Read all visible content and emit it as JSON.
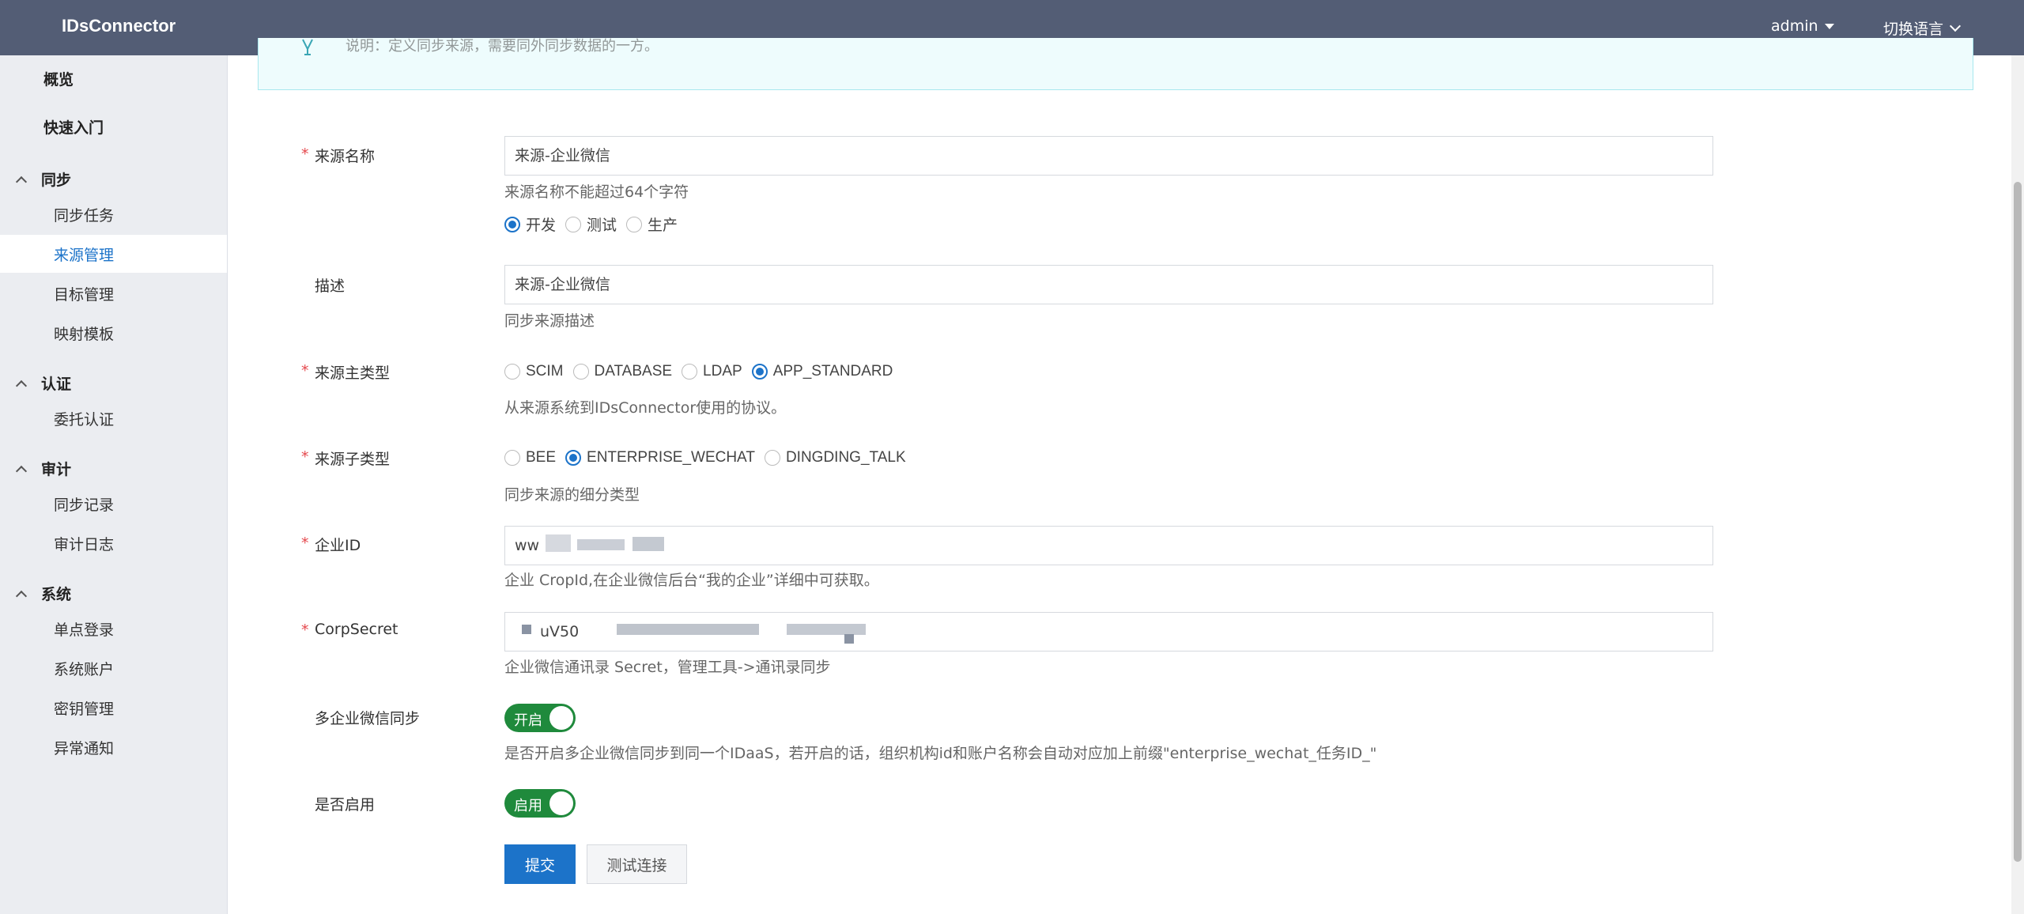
{
  "header": {
    "app_title": "IDsConnector",
    "user": "admin",
    "language": "切换语言"
  },
  "sidebar": {
    "overview": "概览",
    "quickstart": "快速入门",
    "groups": [
      {
        "label": "同步",
        "items": [
          "同步任务",
          "来源管理",
          "目标管理",
          "映射模板"
        ]
      },
      {
        "label": "认证",
        "items": [
          "委托认证"
        ]
      },
      {
        "label": "审计",
        "items": [
          "同步记录",
          "审计日志"
        ]
      },
      {
        "label": "系统",
        "items": [
          "单点登录",
          "系统账户",
          "密钥管理",
          "异常通知"
        ]
      }
    ],
    "active_item": "来源管理"
  },
  "alert": {
    "text": "说明：定义同步来源，需要同外同步数据的一方。"
  },
  "form": {
    "source_name": {
      "label": "来源名称",
      "value": "来源-企业微信",
      "hint": "来源名称不能超过64个字符"
    },
    "env": {
      "options": [
        "开发",
        "测试",
        "生产"
      ],
      "selected": "开发"
    },
    "description": {
      "label": "描述",
      "value": "来源-企业微信",
      "hint": "同步来源描述"
    },
    "main_type": {
      "label": "来源主类型",
      "options": [
        "SCIM",
        "DATABASE",
        "LDAP",
        "APP_STANDARD"
      ],
      "selected": "APP_STANDARD",
      "hint": "从来源系统到IDsConnector使用的协议。"
    },
    "sub_type": {
      "label": "来源子类型",
      "options": [
        "BEE",
        "ENTERPRISE_WECHAT",
        "DINGDING_TALK"
      ],
      "selected": "ENTERPRISE_WECHAT",
      "hint": "同步来源的细分类型"
    },
    "corp_id": {
      "label": "企业ID",
      "value": "ww",
      "hint": "企业 CropId,在企业微信后台“我的企业”详细中可获取。"
    },
    "corp_secret": {
      "label": "CorpSecret",
      "value": "uV50",
      "hint": "企业微信通讯录 Secret，管理工具->通讯录同步"
    },
    "multi_wechat": {
      "label": "多企业微信同步",
      "state": "开启",
      "on": true,
      "hint": "是否开启多企业微信同步到同一个IDaaS，若开启的话，组织机构id和账户名称会自动对应加上前缀\"enterprise_wechat_任务ID_\""
    },
    "enabled": {
      "label": "是否启用",
      "state": "启用",
      "on": true
    },
    "submit": "提交",
    "test": "测试连接"
  },
  "colors": {
    "header_bg": "#535d75",
    "sidebar_bg": "#ebedf1",
    "primary": "#1c73c9",
    "toggle_on": "#1f8a3c",
    "required": "#e5484d"
  }
}
